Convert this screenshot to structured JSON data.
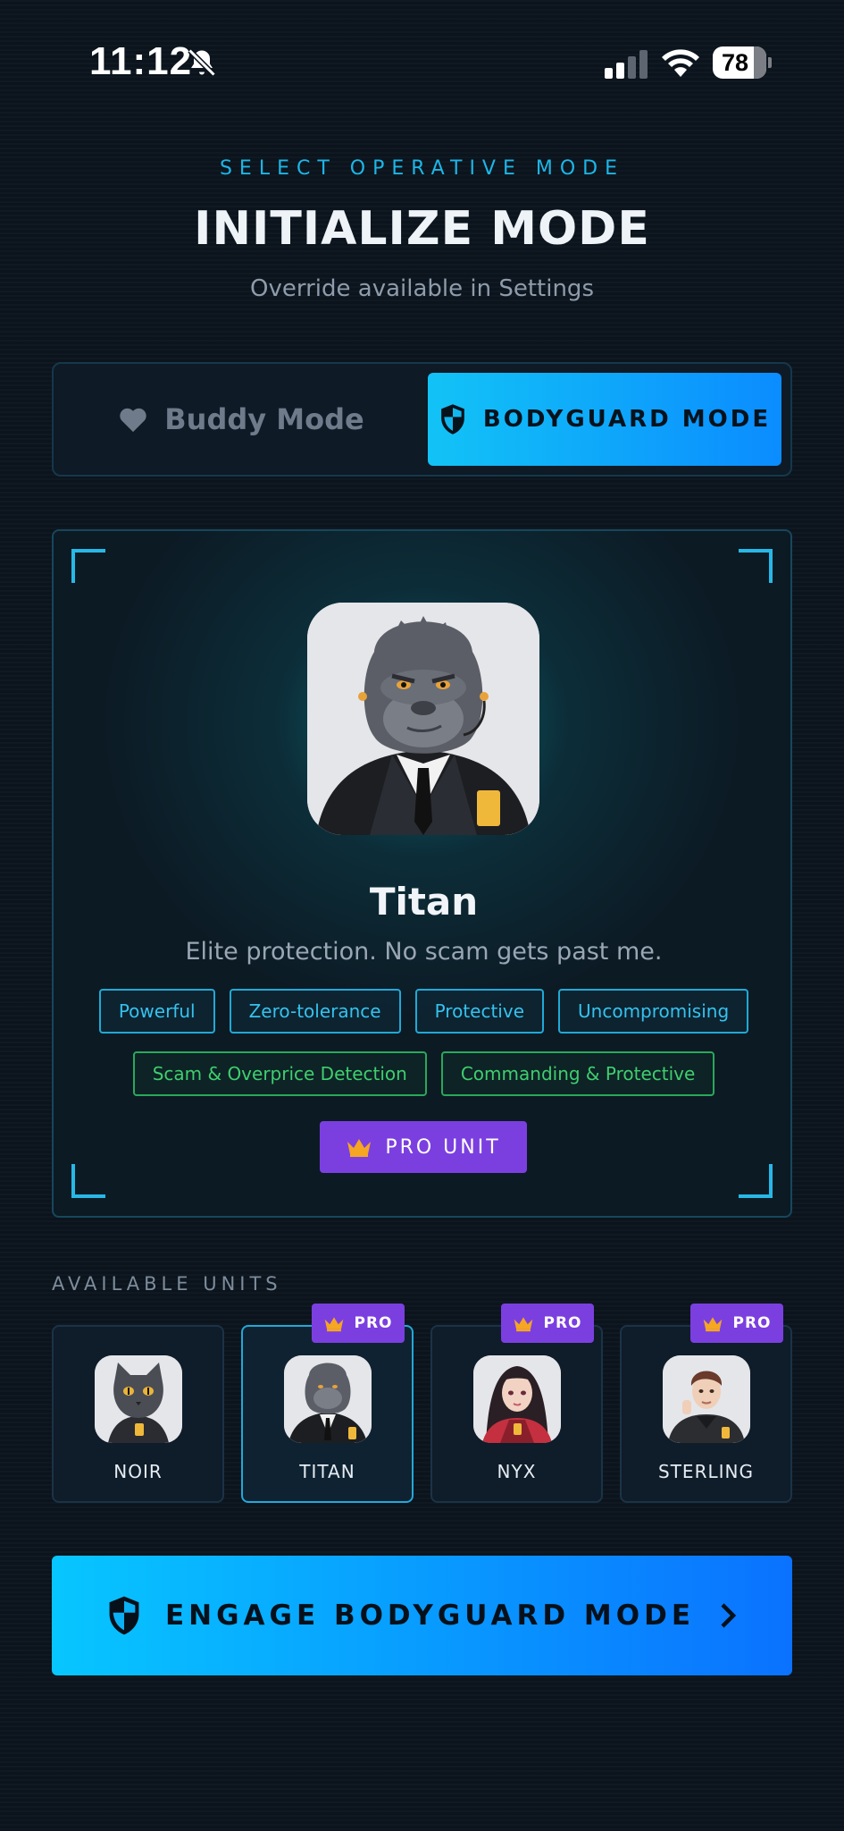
{
  "status_bar": {
    "time": "11:12",
    "battery": "78"
  },
  "header": {
    "eyebrow": "SELECT OPERATIVE MODE",
    "title": "INITIALIZE MODE",
    "subtitle": "Override available in Settings"
  },
  "modes": {
    "buddy_label": "Buddy Mode",
    "bodyguard_label": "BODYGUARD MODE",
    "selected": "bodyguard"
  },
  "featured_unit": {
    "name": "Titan",
    "description": "Elite protection. No scam gets past me.",
    "traits": [
      "Powerful",
      "Zero-tolerance",
      "Protective",
      "Uncompromising"
    ],
    "abilities": [
      "Scam & Overprice Detection",
      "Commanding & Protective"
    ],
    "pro_label": "PRO UNIT"
  },
  "units": {
    "heading": "AVAILABLE UNITS",
    "items": [
      {
        "label": "NOIR",
        "pro": false,
        "selected": false
      },
      {
        "label": "TITAN",
        "pro": true,
        "selected": true
      },
      {
        "label": "NYX",
        "pro": true,
        "selected": false
      },
      {
        "label": "STERLING",
        "pro": true,
        "selected": false
      }
    ],
    "pro_badge": "PRO"
  },
  "cta": {
    "label": "ENGAGE BODYGUARD MODE"
  },
  "colors": {
    "accent": "#12c3f6",
    "accent_end": "#0a72ff",
    "pro": "#7b3fe0",
    "trait": "#35c2ee",
    "ability": "#3fce6f",
    "background": "#0b141d"
  }
}
